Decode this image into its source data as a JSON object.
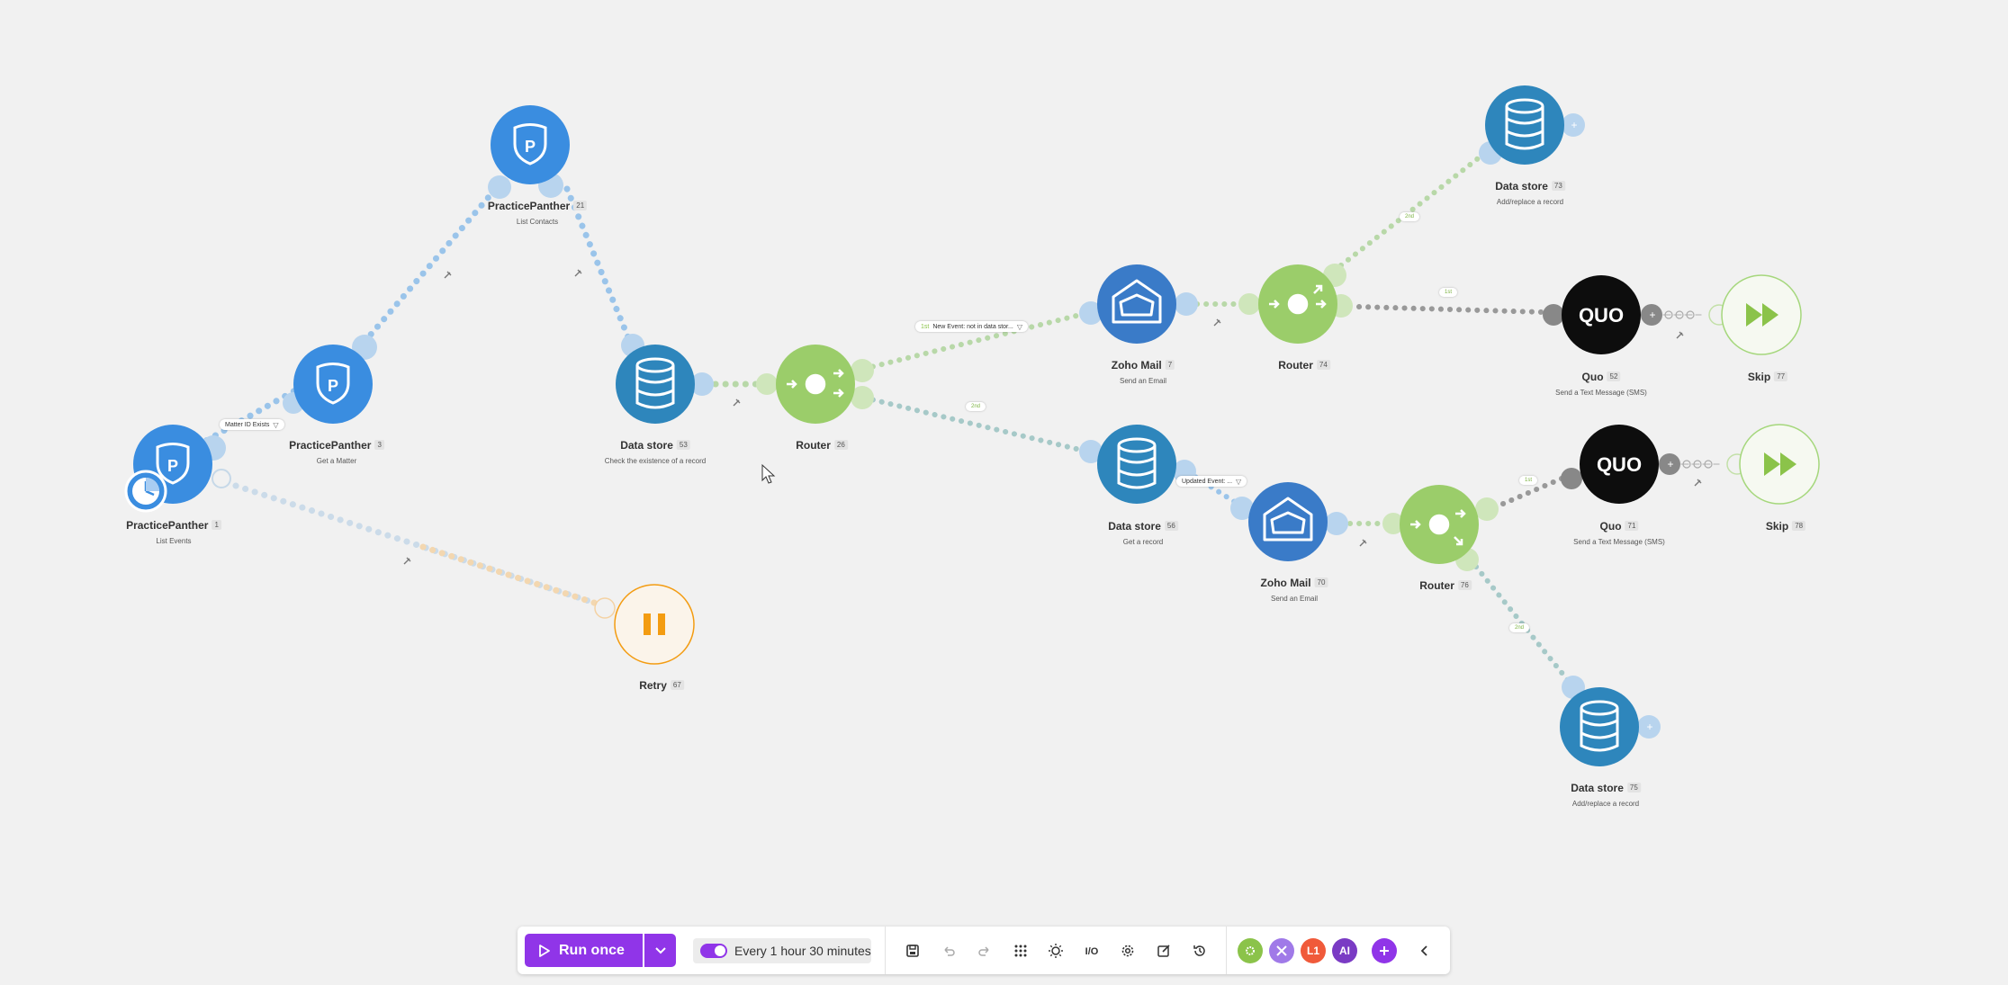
{
  "nodes": {
    "pp_list_events": {
      "title": "PracticePanther",
      "id": "1",
      "sub": "List Events"
    },
    "pp_get_matter": {
      "title": "PracticePanther",
      "id": "3",
      "sub": "Get a Matter"
    },
    "pp_list_contacts": {
      "title": "PracticePanther",
      "id": "21",
      "sub": "List Contacts"
    },
    "ds_check": {
      "title": "Data store",
      "id": "53",
      "sub": "Check the existence of a record"
    },
    "router_26": {
      "title": "Router",
      "id": "26",
      "sub": ""
    },
    "zoho_7": {
      "title": "Zoho Mail",
      "id": "7",
      "sub": "Send an Email"
    },
    "router_74": {
      "title": "Router",
      "id": "74",
      "sub": ""
    },
    "ds_73": {
      "title": "Data store",
      "id": "73",
      "sub": "Add/replace a record"
    },
    "quo_52": {
      "title": "Quo",
      "id": "52",
      "sub": "Send a Text Message (SMS)"
    },
    "skip_77": {
      "title": "Skip",
      "id": "77",
      "sub": ""
    },
    "ds_56": {
      "title": "Data store",
      "id": "56",
      "sub": "Get a record"
    },
    "zoho_70": {
      "title": "Zoho Mail",
      "id": "70",
      "sub": "Send an Email"
    },
    "router_76": {
      "title": "Router",
      "id": "76",
      "sub": ""
    },
    "quo_71": {
      "title": "Quo",
      "id": "71",
      "sub": "Send a Text Message (SMS)"
    },
    "skip_78": {
      "title": "Skip",
      "id": "78",
      "sub": ""
    },
    "ds_75": {
      "title": "Data store",
      "id": "75",
      "sub": "Add/replace a record"
    },
    "retry_67": {
      "title": "Retry",
      "id": "67",
      "sub": ""
    }
  },
  "filters": {
    "matter_id": "Matter ID Exists",
    "new_event": "New Event: not in data stor...",
    "new_event_tag": "1st",
    "updated_event": "Updated Event: ..."
  },
  "route_labels": {
    "r26_2nd": "2nd",
    "r74_1st": "1st",
    "r74_2nd": "2nd",
    "r76_1st": "1st",
    "r76_2nd": "2nd"
  },
  "quo_logo_text": "QUO",
  "toolbar": {
    "run_label": "Run once",
    "schedule_label": "Every 1 hour 30 minutes",
    "ai_label": "AI",
    "l1_label": "L1"
  },
  "colors": {
    "practicepanther": "#3a8de0",
    "datastore": "#2e86bc",
    "zoho": "#3a7bc8",
    "router": "#9bcd6a",
    "quo": "#0d0d0d",
    "retry": "#f39c12",
    "accent": "#9035e8"
  }
}
